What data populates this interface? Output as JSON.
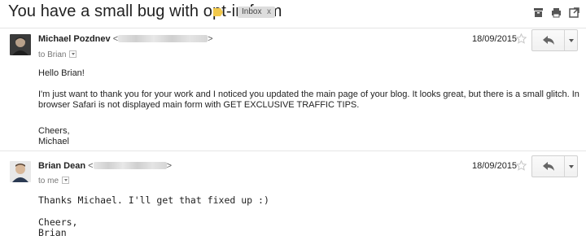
{
  "subject": "You have a small bug with opt-in form",
  "label": "Inbox",
  "label_close": "x",
  "toolbar_icons": [
    "archive-icon",
    "print-icon",
    "new-window-icon"
  ],
  "messages": [
    {
      "sender_name": "Michael Pozdnev",
      "recipient": "to Brian",
      "date": "18/09/2015",
      "greeting": "Hello Brian!",
      "body_line1": "I'm just want to thank you for your work and I noticed you updated the main page of your blog. It looks great, but there is a small glitch. In",
      "body_line2": "browser Safari is not displayed main form with GET EXCLUSIVE TRAFFIC TIPS.",
      "signoff": "Cheers,",
      "signature": "Michael"
    },
    {
      "sender_name": "Brian Dean",
      "recipient": "to me",
      "date": "18/09/2015",
      "body_line1": "Thanks Michael. I'll get that fixed up :)",
      "signoff": "Cheers,",
      "signature": "Brian"
    }
  ]
}
